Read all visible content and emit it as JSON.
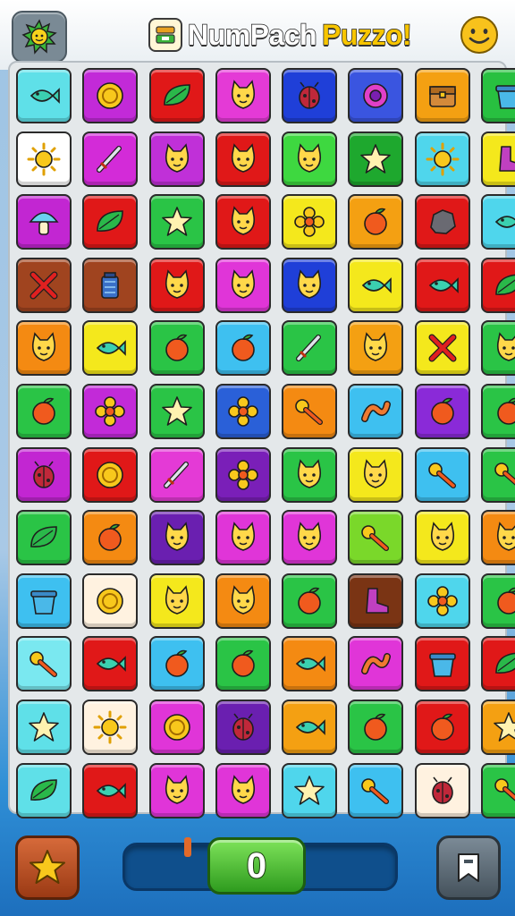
{
  "header": {
    "title_part1": "NumPach",
    "title_part2": "Puzzo!",
    "logo_icon": "sun-icon",
    "title_icon": "puzzle-box-icon",
    "menu_icon": "smiley-icon"
  },
  "board": {
    "columns": 8,
    "rows": 12,
    "tiles": [
      [
        "#5fe0e8",
        "fish"
      ],
      [
        "#c22ad8",
        "coin"
      ],
      [
        "#e01818",
        "leaf"
      ],
      [
        "#e43ad6",
        "cat"
      ],
      [
        "#1f3fd8",
        "bug"
      ],
      [
        "#3a55e0",
        "ring"
      ],
      [
        "#f4a012",
        "chest"
      ],
      [
        "#28c040",
        "pot"
      ],
      [
        "#ffffff",
        "sun"
      ],
      [
        "#d32bd8",
        "sword"
      ],
      [
        "#c030d8",
        "cat"
      ],
      [
        "#e01818",
        "cat"
      ],
      [
        "#3ed840",
        "cat"
      ],
      [
        "#1ea82e",
        "star"
      ],
      [
        "#4fd6ec",
        "sun"
      ],
      [
        "#f4e81c",
        "boot"
      ],
      [
        "#c226d2",
        "mushroom"
      ],
      [
        "#e01818",
        "leaf"
      ],
      [
        "#2ac446",
        "star"
      ],
      [
        "#e01818",
        "cat"
      ],
      [
        "#f4e81c",
        "flower"
      ],
      [
        "#f4a012",
        "fruit"
      ],
      [
        "#e01818",
        "rock"
      ],
      [
        "#4fd6ec",
        "fish"
      ],
      [
        "#a0441f",
        "cross"
      ],
      [
        "#a0441f",
        "jar"
      ],
      [
        "#e01818",
        "cat"
      ],
      [
        "#e035d8",
        "cat"
      ],
      [
        "#1f3fd8",
        "cat"
      ],
      [
        "#f4e81c",
        "fish"
      ],
      [
        "#e01818",
        "fish"
      ],
      [
        "#e01818",
        "leaf"
      ],
      [
        "#f48a12",
        "cat"
      ],
      [
        "#f4e81c",
        "fish"
      ],
      [
        "#2ac446",
        "fruit"
      ],
      [
        "#3ec0f0",
        "fruit"
      ],
      [
        "#2ac446",
        "sword"
      ],
      [
        "#f4a012",
        "cat"
      ],
      [
        "#f4e81c",
        "cross"
      ],
      [
        "#2ac446",
        "cat"
      ],
      [
        "#2ac446",
        "fruit"
      ],
      [
        "#c22ad8",
        "flower"
      ],
      [
        "#2ac446",
        "star"
      ],
      [
        "#2a60d8",
        "flower"
      ],
      [
        "#f48a12",
        "key"
      ],
      [
        "#3ec0f0",
        "worm"
      ],
      [
        "#8a2ad8",
        "fruit"
      ],
      [
        "#2ac446",
        "fruit"
      ],
      [
        "#c226d2",
        "bug"
      ],
      [
        "#e01818",
        "coin"
      ],
      [
        "#e43ad6",
        "sword"
      ],
      [
        "#7a1fb8",
        "flower"
      ],
      [
        "#2ac446",
        "cat"
      ],
      [
        "#f4e81c",
        "cat"
      ],
      [
        "#3ec0f0",
        "key"
      ],
      [
        "#2ac446",
        "key"
      ],
      [
        "#2ac446",
        "leaf"
      ],
      [
        "#f48a12",
        "fruit"
      ],
      [
        "#6a1fb0",
        "cat"
      ],
      [
        "#e035d8",
        "cat"
      ],
      [
        "#e035d8",
        "cat"
      ],
      [
        "#7ad82a",
        "key"
      ],
      [
        "#f4e81c",
        "cat"
      ],
      [
        "#f48a12",
        "cat"
      ],
      [
        "#3ec0f0",
        "pot"
      ],
      [
        "#fff2e0",
        "coin"
      ],
      [
        "#f4e81c",
        "cat"
      ],
      [
        "#f48a12",
        "cat"
      ],
      [
        "#2ac446",
        "fruit"
      ],
      [
        "#7a3414",
        "boot"
      ],
      [
        "#4fd6ec",
        "flower"
      ],
      [
        "#2ac446",
        "fruit"
      ],
      [
        "#7ae8f0",
        "key"
      ],
      [
        "#e01818",
        "fish"
      ],
      [
        "#3ec0f0",
        "fruit"
      ],
      [
        "#2ac446",
        "fruit"
      ],
      [
        "#f48a12",
        "fish"
      ],
      [
        "#e035d8",
        "worm"
      ],
      [
        "#e01818",
        "pot"
      ],
      [
        "#e01818",
        "leaf"
      ],
      [
        "#5fe0e8",
        "star"
      ],
      [
        "#fff2e0",
        "sun"
      ],
      [
        "#e035d8",
        "coin"
      ],
      [
        "#6a1fb0",
        "bug"
      ],
      [
        "#f4a012",
        "fish"
      ],
      [
        "#2ac446",
        "fruit"
      ],
      [
        "#e01818",
        "fruit"
      ],
      [
        "#f4a012",
        "star"
      ],
      [
        "#5fe0e8",
        "leaf"
      ],
      [
        "#e01818",
        "fish"
      ],
      [
        "#e035d8",
        "cat"
      ],
      [
        "#e035d8",
        "cat"
      ],
      [
        "#4fd6ec",
        "star"
      ],
      [
        "#3ec0f0",
        "key"
      ],
      [
        "#fff2e0",
        "bug"
      ],
      [
        "#2ac446",
        "key"
      ]
    ]
  },
  "footer": {
    "left_icon": "star-icon",
    "score": "0",
    "progress_percent": 0,
    "right_icon": "bookmark-icon"
  }
}
